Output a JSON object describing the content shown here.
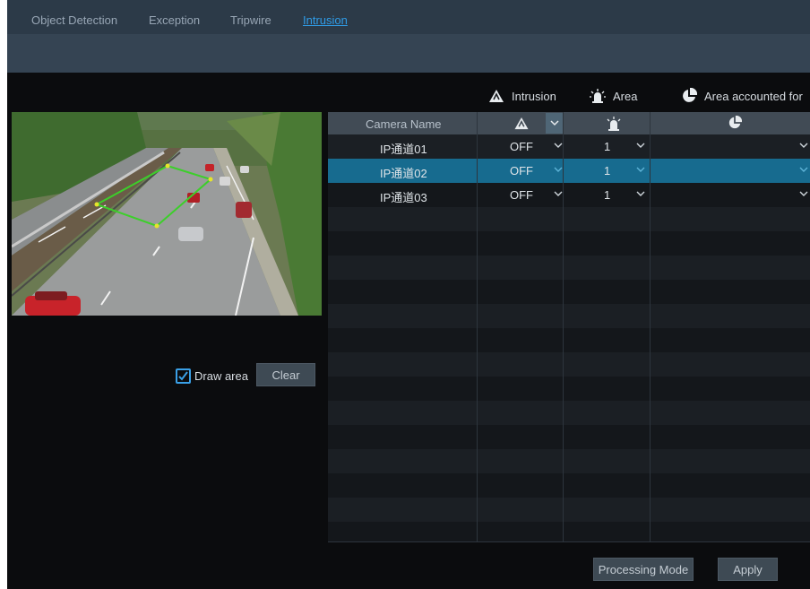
{
  "tabs": [
    {
      "label": "Object Detection",
      "active": false
    },
    {
      "label": "Exception",
      "active": false
    },
    {
      "label": "Tripwire",
      "active": false
    },
    {
      "label": "Intrusion",
      "active": true
    }
  ],
  "legend": {
    "intrusion": "Intrusion",
    "area": "Area",
    "area_accounted": "Area accounted for"
  },
  "table": {
    "header_camera": "Camera Name",
    "rows": [
      {
        "camera": "IP通道01",
        "intrusion": "OFF",
        "area": "1",
        "accounted": "",
        "selected": false
      },
      {
        "camera": "IP通道02",
        "intrusion": "OFF",
        "area": "1",
        "accounted": "",
        "selected": true
      },
      {
        "camera": "IP通道03",
        "intrusion": "OFF",
        "area": "1",
        "accounted": "",
        "selected": false
      }
    ]
  },
  "controls": {
    "draw_area_label": "Draw area",
    "draw_area_checked": true,
    "clear_label": "Clear",
    "processing_mode_label": "Processing Mode",
    "apply_label": "Apply"
  },
  "colors": {
    "accent": "#2f9be6",
    "selected_row": "#176b8f",
    "tab_bar": "#2c3a48",
    "intrusion_polygon": "#3ccf2a"
  }
}
